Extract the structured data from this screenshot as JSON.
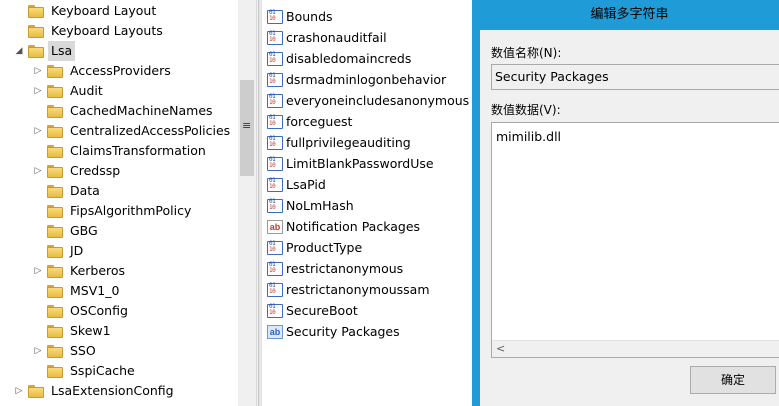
{
  "tree": {
    "items": [
      {
        "label": "Keyboard Layout",
        "expander": "",
        "level": 1
      },
      {
        "label": "Keyboard Layouts",
        "expander": "",
        "level": 1
      },
      {
        "label": "Lsa",
        "expander": "◢",
        "level": 1,
        "selected": true
      },
      {
        "label": "AccessProviders",
        "expander": "▷",
        "level": 2
      },
      {
        "label": "Audit",
        "expander": "▷",
        "level": 2
      },
      {
        "label": "CachedMachineNames",
        "expander": "",
        "level": 2
      },
      {
        "label": "CentralizedAccessPolicies",
        "expander": "▷",
        "level": 2
      },
      {
        "label": "ClaimsTransformation",
        "expander": "",
        "level": 2
      },
      {
        "label": "Credssp",
        "expander": "▷",
        "level": 2
      },
      {
        "label": "Data",
        "expander": "",
        "level": 2
      },
      {
        "label": "FipsAlgorithmPolicy",
        "expander": "",
        "level": 2
      },
      {
        "label": "GBG",
        "expander": "",
        "level": 2
      },
      {
        "label": "JD",
        "expander": "",
        "level": 2
      },
      {
        "label": "Kerberos",
        "expander": "▷",
        "level": 2
      },
      {
        "label": "MSV1_0",
        "expander": "",
        "level": 2
      },
      {
        "label": "OSConfig",
        "expander": "",
        "level": 2
      },
      {
        "label": "Skew1",
        "expander": "",
        "level": 2
      },
      {
        "label": "SSO",
        "expander": "▷",
        "level": 2
      },
      {
        "label": "SspiCache",
        "expander": "",
        "level": 2
      },
      {
        "label": "LsaExtensionConfig",
        "expander": "▷",
        "level": 1
      }
    ]
  },
  "values": {
    "items": [
      {
        "label": "Bounds",
        "type": "bin"
      },
      {
        "label": "crashonauditfail",
        "type": "bin"
      },
      {
        "label": "disabledomaincreds",
        "type": "bin"
      },
      {
        "label": "dsrmadminlogonbehavior",
        "type": "bin"
      },
      {
        "label": "everyoneincludesanonymous",
        "type": "bin"
      },
      {
        "label": "forceguest",
        "type": "bin"
      },
      {
        "label": "fullprivilegeauditing",
        "type": "bin"
      },
      {
        "label": "LimitBlankPasswordUse",
        "type": "bin"
      },
      {
        "label": "LsaPid",
        "type": "bin"
      },
      {
        "label": "NoLmHash",
        "type": "bin"
      },
      {
        "label": "Notification Packages",
        "type": "str"
      },
      {
        "label": "ProductType",
        "type": "bin"
      },
      {
        "label": "restrictanonymous",
        "type": "bin"
      },
      {
        "label": "restrictanonymoussam",
        "type": "bin"
      },
      {
        "label": "SecureBoot",
        "type": "bin"
      },
      {
        "label": "Security Packages",
        "type": "str-sel"
      }
    ]
  },
  "dialog": {
    "title": "编辑多字符串",
    "name_label": "数值名称(N):",
    "name_value": "Security Packages",
    "data_label": "数值数据(V):",
    "data_value": "mimilib.dll",
    "ok_label": "确定",
    "scroll_left": "<"
  },
  "splitter": {
    "grip": "≡"
  },
  "colors": {
    "title_bar": "#1f9bd7",
    "dialog_bg": "#f0f0f0",
    "selection": "#d9d9d9"
  }
}
